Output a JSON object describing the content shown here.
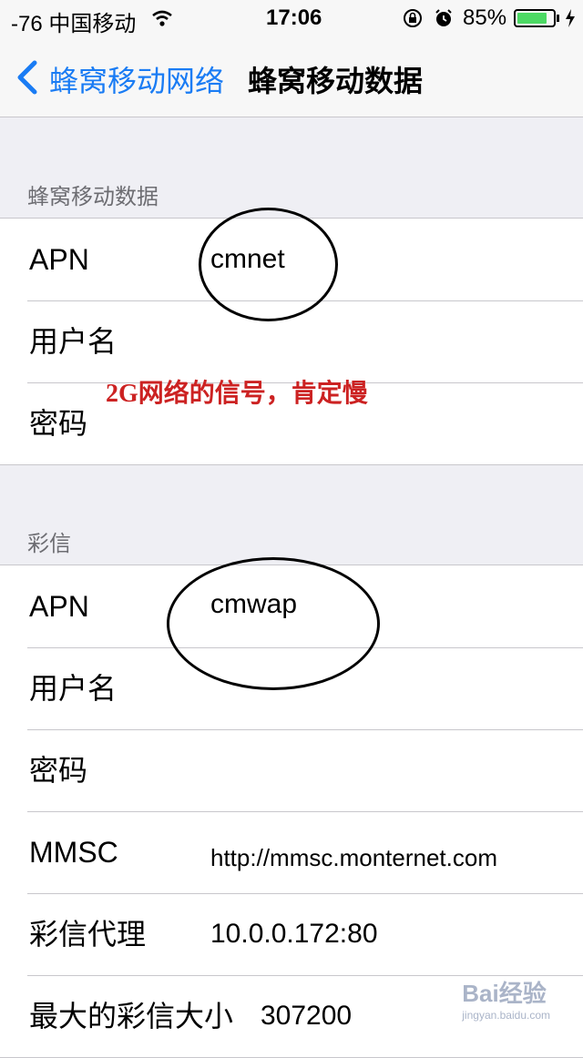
{
  "status_bar": {
    "signal_carrier": "-76 中国移动",
    "time": "17:06",
    "battery_percent": "85%",
    "battery_level": 0.85,
    "icons": [
      "wifi-icon",
      "rotation-lock-icon",
      "alarm-icon",
      "battery-icon",
      "charging-icon"
    ]
  },
  "nav": {
    "back_label": "蜂窝移动网络",
    "title": "蜂窝移动数据",
    "accent": "#1a7cf4"
  },
  "sections": [
    {
      "header": "蜂窝移动数据",
      "rows": [
        {
          "label": "APN",
          "value": "cmnet"
        },
        {
          "label": "用户名",
          "value": ""
        },
        {
          "label": "密码",
          "value": ""
        }
      ]
    },
    {
      "header": "彩信",
      "rows": [
        {
          "label": "APN",
          "value": "cmwap"
        },
        {
          "label": "用户名",
          "value": ""
        },
        {
          "label": "密码",
          "value": ""
        },
        {
          "label": "MMSC",
          "value": "http://mmsc.monternet.com"
        },
        {
          "label": "彩信代理",
          "value": "10.0.0.172:80"
        },
        {
          "label": "最大的彩信大小",
          "value": "307200"
        }
      ]
    }
  ],
  "annotation": {
    "text": "2G网络的信号，肯定慢",
    "color": "#cc2222"
  },
  "watermark": {
    "brand": "Bai经验",
    "url": "jingyan.baidu.com"
  }
}
